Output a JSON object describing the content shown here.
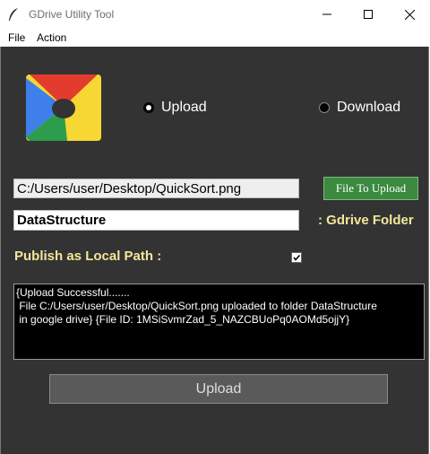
{
  "window": {
    "title": "GDrive Utility Tool"
  },
  "menu": {
    "file": "File",
    "action": "Action"
  },
  "mode": {
    "upload_label": "Upload",
    "download_label": "Download",
    "selected": "Upload"
  },
  "file_path": {
    "value": "C:/Users/user/Desktop/QuickSort.png"
  },
  "file_button": {
    "label": "File To Upload"
  },
  "folder": {
    "value": "DataStructure",
    "label": ": Gdrive Folder"
  },
  "publish": {
    "label": "Publish as Local Path :",
    "checked": true
  },
  "log": {
    "text": "{Upload Successful.......\n File C:/Users/user/Desktop/QuickSort.png uploaded to folder DataStructure\n in google drive} {File ID: 1MSiSvmrZad_5_NAZCBUoPq0AOMd5ojjY}"
  },
  "action_button": {
    "label": "Upload"
  },
  "colors": {
    "panel": "#333333",
    "accent_green": "#3b8a3f",
    "label_yellow": "#f3e79a",
    "logo_red": "#e33b2e",
    "logo_blue": "#3f7fea",
    "logo_yellow": "#f7d733",
    "logo_green": "#2b9d4c"
  }
}
